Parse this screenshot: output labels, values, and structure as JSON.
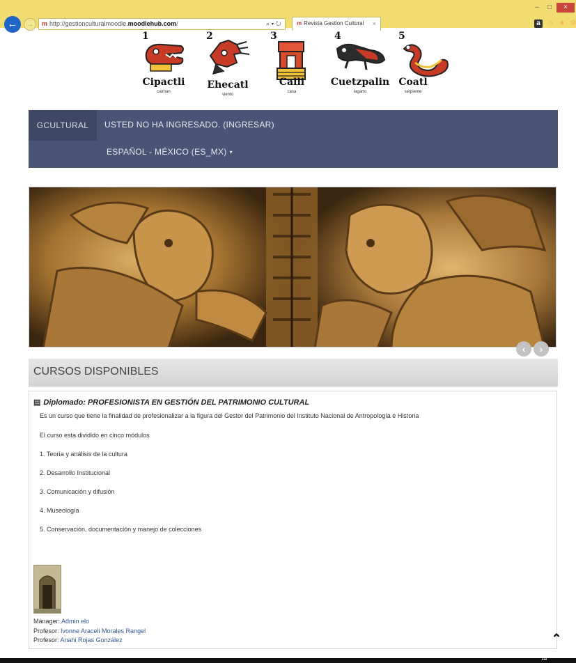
{
  "browser": {
    "url_prefix": "http://gestionculturalmoodle.",
    "url_host": "moodlehub.com",
    "url_suffix": "/",
    "address_tools": "⌕ ▾ ↻",
    "tab_title": "Revista Gestion Cultural",
    "tab_close": "×",
    "back_glyph": "←",
    "forward_glyph": "→",
    "favicon": "m",
    "amazon_icon": "a",
    "icons": [
      "back-arrow-icon",
      "forward-arrow-icon",
      "search-icon",
      "refresh-icon",
      "home-icon",
      "star-icon",
      "gear-icon",
      "amazon-icon"
    ],
    "window_min": "–",
    "window_max": "□",
    "window_close": "×"
  },
  "header": {
    "glyphs": [
      {
        "num": "1",
        "name": "Cipactli",
        "sub": "caiman",
        "color": "#c73a26"
      },
      {
        "num": "2",
        "name": "Ehecatl",
        "sub": "viento",
        "color": "#c73a26"
      },
      {
        "num": "3",
        "name": "Calli",
        "sub": "casa",
        "color": "#d44a2a"
      },
      {
        "num": "4",
        "name": "Cuetzpalin",
        "sub": "lagarto",
        "color": "#c73a26"
      },
      {
        "num": "5",
        "name": "Coatl",
        "sub": "serpiente",
        "color": "#c73a26"
      }
    ]
  },
  "navbar": {
    "brand": "GCULTURAL",
    "login": "USTED NO HA INGRESADO. (INGRESAR)",
    "language": "ESPAÑOL - MÉXICO (ES_MX)",
    "language_caret": "▾",
    "bg_color": "#4a5575"
  },
  "slider": {
    "prev_glyph": "‹",
    "next_glyph": "›"
  },
  "courses": {
    "heading": "CURSOS DISPONIBLES",
    "course": {
      "book_icon": "▤",
      "title_prefix": "Diplomado: ",
      "title": "PROFESIONISTA EN GESTIÓN DEL PATRIMONIO CULTURAL",
      "description": "Es un curso que tiene la finalidad de profesionalizar  a la figura del Gestor del Patrimonio del Instituto Nacional de Antropología e Historia",
      "intro": "El curso esta dividido en cinco módulos",
      "modules": [
        "1. Teoría y análisis de la cultura",
        "2. Desarrollo Institucional",
        "3. Comunicación y difusión",
        "4. Museología",
        "5. Conservación, documentación y manejo de colecciones"
      ],
      "staff": [
        {
          "role": "Mánager: ",
          "name": "Admin elo"
        },
        {
          "role": "Profesor: ",
          "name": "Ivonne Araceli Morales Rangel"
        },
        {
          "role": "Profesor: ",
          "name": "Anahi Rojas González"
        }
      ]
    }
  },
  "footer": {
    "to_top_glyph": "⌃",
    "dots": "•••"
  }
}
